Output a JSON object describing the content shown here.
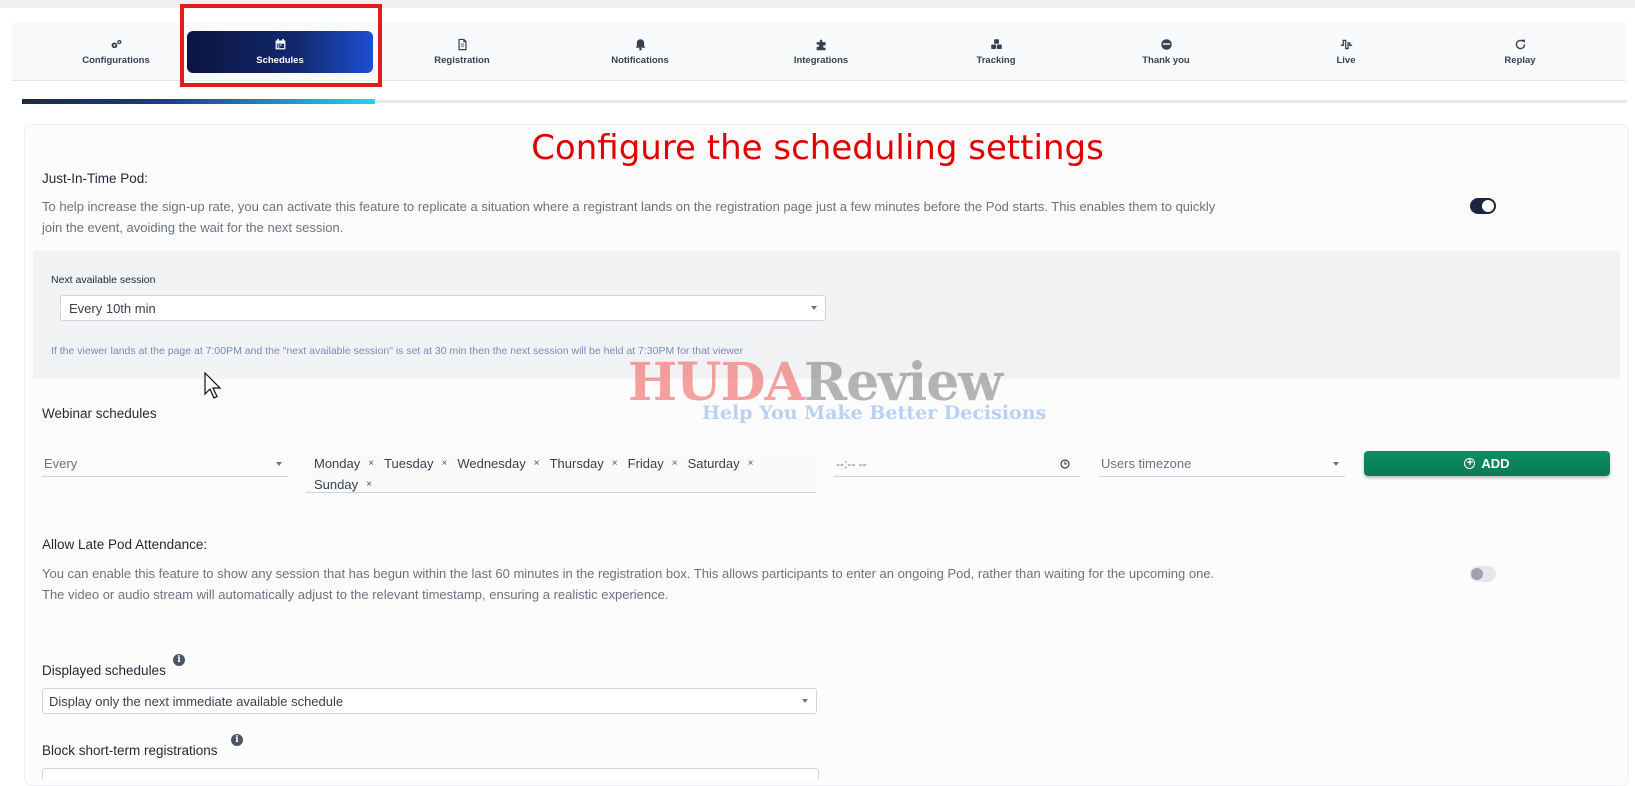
{
  "tabs": [
    {
      "label": "Configurations",
      "icon": "gears-icon"
    },
    {
      "label": "Schedules",
      "icon": "calendar-icon",
      "active": true
    },
    {
      "label": "Registration",
      "icon": "document-icon"
    },
    {
      "label": "Notifications",
      "icon": "bell-icon"
    },
    {
      "label": "Integrations",
      "icon": "puzzle-icon"
    },
    {
      "label": "Tracking",
      "icon": "cubes-icon"
    },
    {
      "label": "Thank you",
      "icon": "smile-icon"
    },
    {
      "label": "Live",
      "icon": "pulse-icon"
    },
    {
      "label": "Replay",
      "icon": "replay-icon"
    }
  ],
  "progress": {
    "value": 0.22
  },
  "overlay": {
    "title": "Configure the scheduling settings"
  },
  "jit": {
    "label": "Just-In-Time Pod:",
    "description_line1": "To help increase the sign-up rate, you can activate this feature to replicate a situation where a registrant lands on the registration page just a few minutes before the Pod starts. This enables them to quickly",
    "description_line2": "join the event, avoiding the wait for the next session.",
    "enabled": true,
    "next_session_label": "Next available session",
    "next_session_value": "Every 10th min",
    "hint": "If the viewer lands at the page at 7:00PM and the \"next available session\" is set at 30 min then the next session will be held at 7:30PM for that viewer"
  },
  "watermark": {
    "part1": "HUDA",
    "part2": "Review",
    "tagline": "Help You Make Better Decisions"
  },
  "webinar": {
    "label": "Webinar schedules",
    "frequency": "Every",
    "days": [
      "Monday",
      "Tuesday",
      "Wednesday",
      "Thursday",
      "Friday",
      "Saturday",
      "Sunday"
    ],
    "remove_symbol": "×",
    "time_placeholder": "--:-- --",
    "timezone": "Users timezone",
    "add_label": "ADD"
  },
  "late": {
    "label": "Allow Late Pod Attendance:",
    "description_line1": "You can enable this feature to show any session that has begun within the last 60 minutes in the registration box. This allows participants to enter an ongoing Pod, rather than waiting for the upcoming one.",
    "description_line2": "The video or audio stream will automatically adjust to the relevant timestamp, ensuring a realistic experience.",
    "enabled": false
  },
  "displayed": {
    "label": "Displayed schedules",
    "value": "Display only the next immediate available schedule"
  },
  "block": {
    "label": "Block short-term registrations"
  },
  "colors": {
    "accent": "#12296e",
    "add_button": "#0f8f63",
    "highlight": "#e11d1d"
  }
}
